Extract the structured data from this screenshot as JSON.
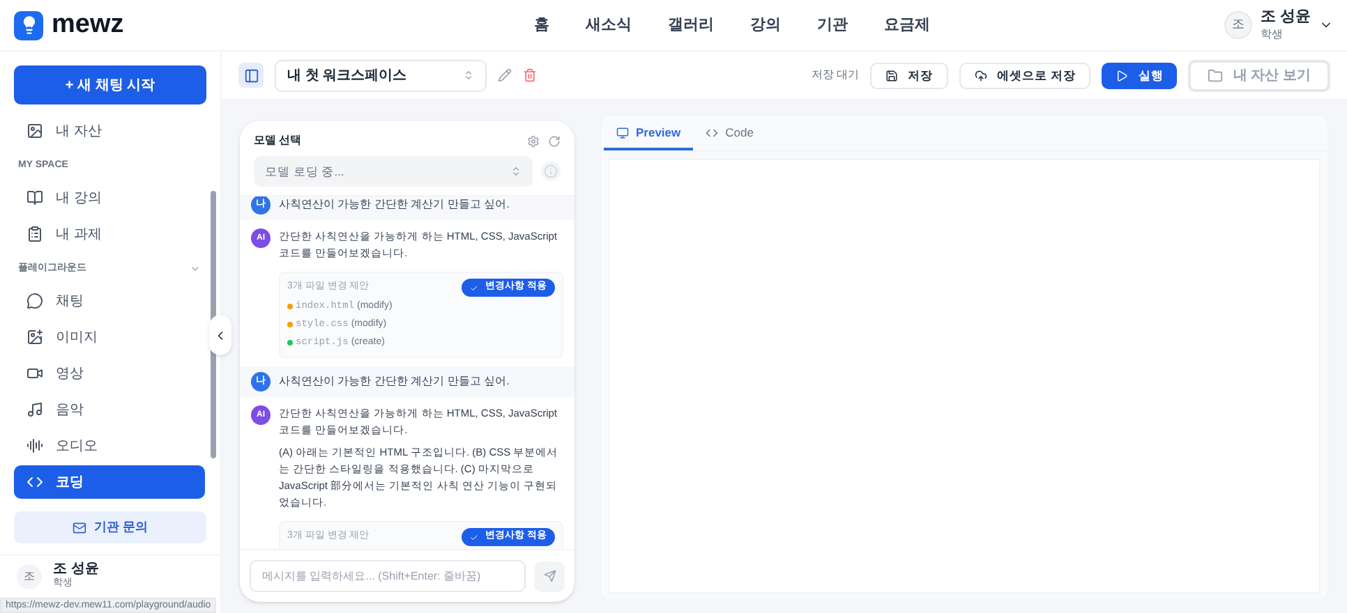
{
  "header": {
    "logo": "mewz",
    "nav": [
      "홈",
      "새소식",
      "갤러리",
      "강의",
      "기관",
      "요금제"
    ],
    "user": {
      "avatar": "조",
      "name": "조 성윤",
      "role": "학생"
    }
  },
  "sidebar": {
    "new_chat": "+ 새 채팅 시작",
    "items": [
      {
        "kind": "item",
        "label": "내 자산",
        "selected": false
      },
      {
        "kind": "section",
        "label": "MY SPACE"
      },
      {
        "kind": "item",
        "label": "내 강의",
        "selected": false
      },
      {
        "kind": "item",
        "label": "내 과제",
        "selected": false
      },
      {
        "kind": "section",
        "label": "플레이그라운드",
        "expanded": true
      },
      {
        "kind": "item",
        "label": "채팅",
        "selected": false
      },
      {
        "kind": "item",
        "label": "이미지",
        "selected": false
      },
      {
        "kind": "item",
        "label": "영상",
        "selected": false
      },
      {
        "kind": "item",
        "label": "음악",
        "selected": false
      },
      {
        "kind": "item",
        "label": "오디오",
        "selected": false
      },
      {
        "kind": "item",
        "label": "코딩",
        "selected": true
      }
    ],
    "contact": "기관 문의",
    "user": {
      "avatar": "조",
      "name": "조 성윤",
      "role": "학생"
    }
  },
  "toolbar": {
    "workspace": "내 첫 워크스페이스",
    "save_status": "저장 대기",
    "buttons": [
      {
        "kind": "outline",
        "label": "저장"
      },
      {
        "kind": "outline",
        "label": "에셋으로 저장"
      },
      {
        "kind": "primary",
        "label": "실행"
      },
      {
        "kind": "disabled",
        "label": "내 자산 보기"
      }
    ]
  },
  "chat": {
    "title": "모델 선택",
    "model_placeholder": "모델 로딩 중...",
    "messages": [
      {
        "kind": "user",
        "avatar": "나",
        "text": "사칙연산이 가능한 간단한 계산기 만들고 싶어."
      },
      {
        "kind": "ai",
        "avatar": "AI",
        "paragraphs": [
          "간단한 사칙연산을 가능하게 하는 HTML, CSS, JavaScript 코드를 만들어보겠습니다."
        ],
        "proposal": {
          "title": "3개 파일 변경 제안",
          "button": "변경사항 적용",
          "files": [
            {
              "name": "index.html",
              "action": "(modify)",
              "color": "#f59e0b"
            },
            {
              "name": "style.css",
              "action": "(modify)",
              "color": "#f59e0b"
            },
            {
              "name": "script.js",
              "action": "(create)",
              "color": "#22c55e"
            }
          ]
        }
      },
      {
        "kind": "user",
        "avatar": "나",
        "text": "사칙연산이 가능한 간단한 계산기 만들고 싶어."
      },
      {
        "kind": "ai",
        "avatar": "AI",
        "paragraphs": [
          "간단한 사칙연산을 가능하게 하는 HTML, CSS, JavaScript 코드를 만들어보겠습니다.",
          "(A) 아래는 기본적인 HTML 구조입니다. (B) CSS 부분에서는 간단한 스타일링을 적용했습니다. (C) 마지막으로 JavaScript 部分에서는 기본적인 사칙 연산 기능이 구현되었습니다."
        ],
        "proposal": {
          "title": "3개 파일 변경 제안",
          "button": "변경사항 적용"
        }
      }
    ],
    "input_placeholder": "메시지를 입력하세요... (Shift+Enter: 줄바꿈)"
  },
  "preview": {
    "tabs": [
      {
        "label": "Preview",
        "selected": true
      },
      {
        "label": "Code",
        "selected": false
      }
    ]
  },
  "status_url": "https://mewz-dev.mew11.com/playground/audio"
}
